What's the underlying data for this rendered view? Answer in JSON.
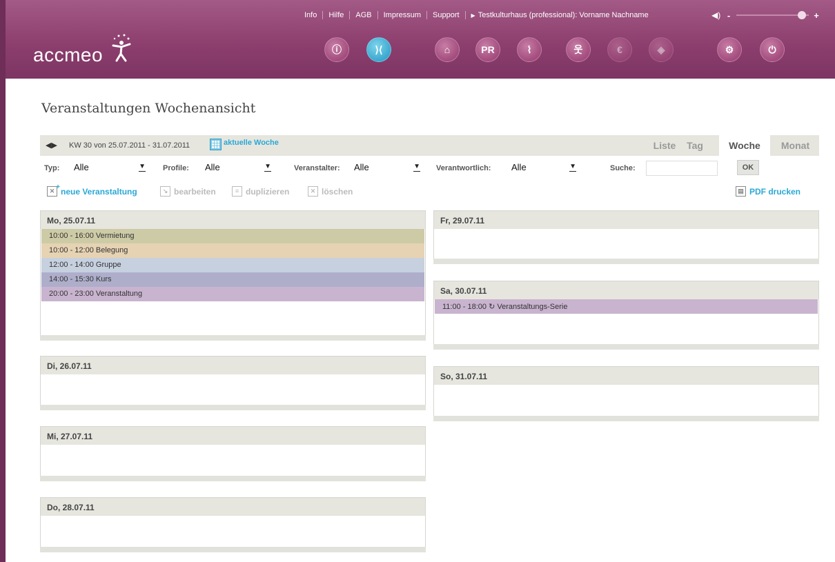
{
  "topbar": {
    "links": [
      "Info",
      "Hilfe",
      "AGB",
      "Impressum",
      "Support"
    ],
    "user": "Testkulturhaus (professional): Vorname Nachname"
  },
  "volume": {
    "level": 0.9
  },
  "logo": {
    "text": "accmeo"
  },
  "nav_icons": [
    {
      "name": "info-icon",
      "glyph": "ⓘ",
      "state": "normal"
    },
    {
      "name": "event-icon",
      "glyph": "⟩⟨",
      "state": "active"
    },
    {
      "name": "home-icon",
      "glyph": "⌂",
      "state": "normal"
    },
    {
      "name": "pr-icon",
      "glyph": "PR",
      "state": "normal"
    },
    {
      "name": "paperclip-icon",
      "glyph": "⌇",
      "state": "normal"
    },
    {
      "name": "people-icon",
      "glyph": "웃",
      "state": "normal"
    },
    {
      "name": "euro-icon",
      "glyph": "€",
      "state": "dim"
    },
    {
      "name": "ticket-icon",
      "glyph": "◈",
      "state": "dim"
    },
    {
      "name": "settings-icon",
      "glyph": "⚙",
      "state": "normal"
    },
    {
      "name": "power-icon",
      "glyph": "⏻",
      "state": "normal"
    }
  ],
  "page": {
    "title": "Veranstaltungen Wochenansicht"
  },
  "week": {
    "range": "KW 30 von 25.07.2011 - 31.07.2011",
    "current_label": "aktuelle Woche",
    "tabs": [
      "Liste",
      "Tag",
      "Woche",
      "Monat"
    ],
    "active_tab": "Woche"
  },
  "filters": {
    "typ_label": "Typ:",
    "typ_value": "Alle",
    "profile_label": "Profile:",
    "profile_value": "Alle",
    "veranstalter_label": "Veranstalter:",
    "veranstalter_value": "Alle",
    "verantwortlich_label": "Verantwortlich:",
    "verantwortlich_value": "Alle",
    "suche_label": "Suche:",
    "suche_value": "",
    "ok_label": "OK"
  },
  "actions": {
    "new": "neue Veranstaltung",
    "edit": "bearbeiten",
    "duplicate": "duplizieren",
    "delete": "löschen",
    "pdf": "PDF drucken"
  },
  "days": {
    "mo": {
      "label": "Mo, 25.07.11",
      "events": [
        {
          "text": "10:00 - 16:00 Vermietung",
          "color": "#cdcba6"
        },
        {
          "text": "10:00 - 12:00 Belegung",
          "color": "#e6d3b3"
        },
        {
          "text": "12:00 - 14:00 Gruppe",
          "color": "#c6d0df"
        },
        {
          "text": "14:00 - 15:30 Kurs",
          "color": "#aeaecb"
        },
        {
          "text": "20:00 - 23:00 Veranstaltung",
          "color": "#c9b4cf"
        }
      ]
    },
    "di": {
      "label": "Di, 26.07.11",
      "events": []
    },
    "mi": {
      "label": "Mi, 27.07.11",
      "events": []
    },
    "do": {
      "label": "Do, 28.07.11",
      "events": []
    },
    "fr": {
      "label": "Fr, 29.07.11",
      "events": []
    },
    "sa": {
      "label": "Sa, 30.07.11",
      "events": [
        {
          "text": "11:00 - 18:00 ↻ Veranstaltungs-Serie",
          "color": "#c9b4cf"
        }
      ]
    },
    "so": {
      "label": "So, 31.07.11",
      "events": []
    }
  }
}
